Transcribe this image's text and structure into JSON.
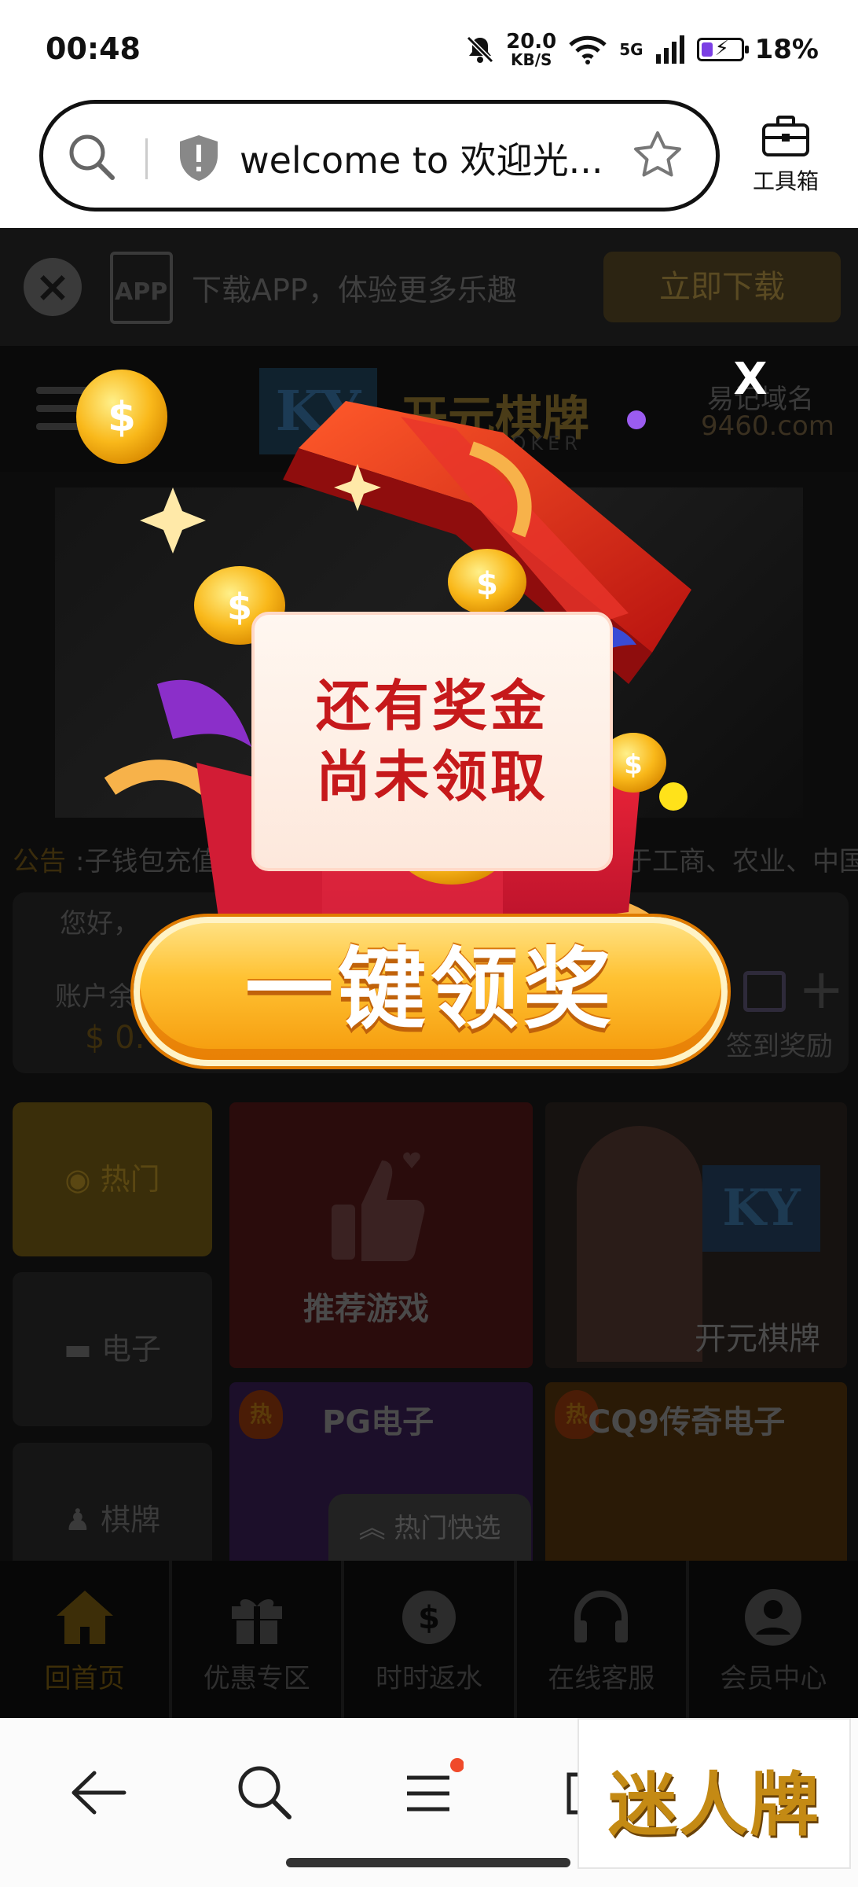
{
  "status_bar": {
    "time": "00:48",
    "net_speed_value": "20.0",
    "net_speed_unit": "KB/S",
    "signal_type": "5G",
    "battery_percent": "18%"
  },
  "url_bar": {
    "url_text": "welcome to 欢迎光...",
    "toolbox_label": "工具箱"
  },
  "app_banner": {
    "app_icon_text": "APP",
    "text": "下载APP，体验更多乐趣",
    "download_label": "立即下载"
  },
  "header": {
    "logo_letters": "KY",
    "logo_name": "开元棋牌",
    "logo_sub": "POKER",
    "domain_label": "易记域名",
    "domain": "9460.com"
  },
  "notice": {
    "tag": "公告",
    "text_left": ":子钱包充值",
    "text_right": "于工商、农业、中国"
  },
  "account": {
    "greeting": "您好，",
    "balance_label": "账户余",
    "balance_value": "$ 0.",
    "sign_in_label": "签到奖励"
  },
  "categories": [
    {
      "label": "热门"
    },
    {
      "label": "电子"
    },
    {
      "label": "棋牌"
    }
  ],
  "tiles": {
    "recommend": "推荐游戏",
    "kaiyuan": "开元棋牌",
    "kaiyuan_logo": "KY",
    "pg": "PG电子",
    "cq9": "CQ9传奇电子",
    "hot_badge": "热"
  },
  "quick_select": "热门快选",
  "bottom_nav": [
    {
      "label": "回首页"
    },
    {
      "label": "优惠专区"
    },
    {
      "label": "时时返水"
    },
    {
      "label": "在线客服"
    },
    {
      "label": "会员中心"
    }
  ],
  "popup": {
    "close_label": "X",
    "message_line1": "还有奖金",
    "message_line2": "尚未领取",
    "claim_button": "一键领奖"
  },
  "ad": {
    "text": "迷人牌"
  },
  "colors": {
    "accent_gold": "#ffc233",
    "popup_red": "#c6191b",
    "battery_purple": "#7b3fe4"
  }
}
